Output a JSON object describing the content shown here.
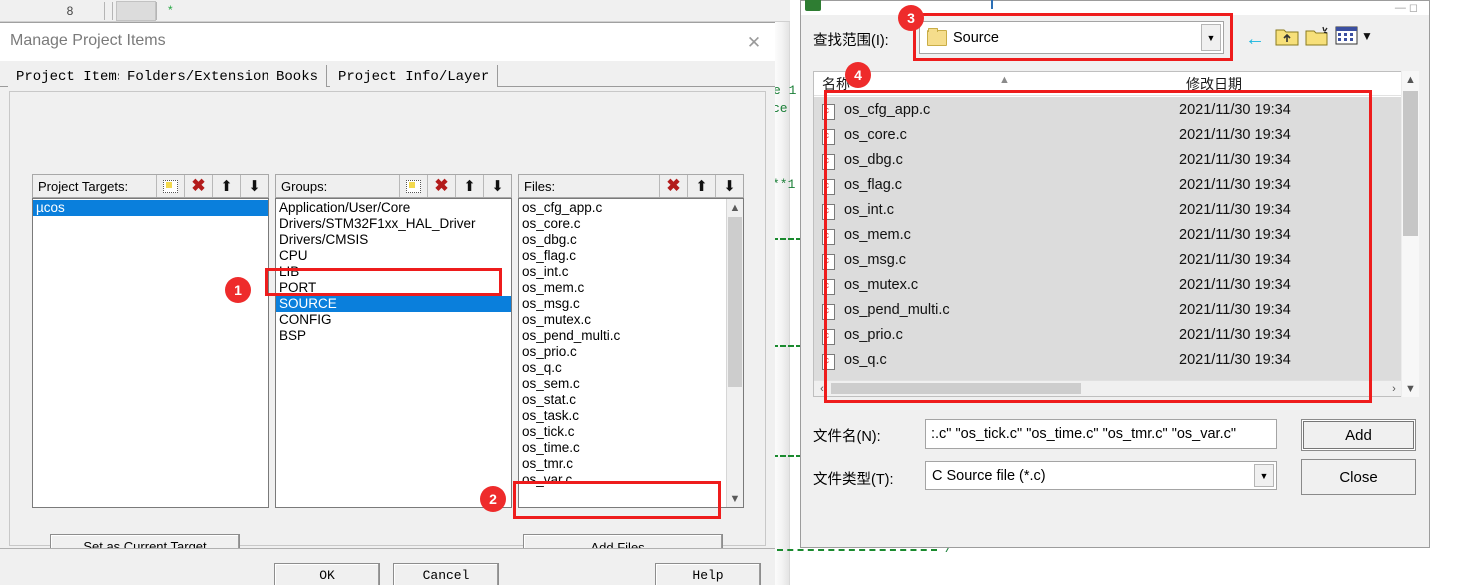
{
  "ide": {
    "toolbar_value": "8",
    "modified_marker": "*"
  },
  "editor": {
    "code_fragments": [
      "e 1",
      "ce",
      "**1"
    ]
  },
  "manage_dialog": {
    "title": "Manage Project Items",
    "close_icon": "close-icon",
    "tabs": [
      {
        "label": "Project Items",
        "active": true
      },
      {
        "label": "Folders/Extensions",
        "active": false
      },
      {
        "label": "Books",
        "active": false
      },
      {
        "label": "Project Info/Layer",
        "active": false
      }
    ],
    "project_targets": {
      "label": "Project Targets:",
      "toolbar_icons": [
        "new-item-icon",
        "delete-icon",
        "move-up-icon",
        "move-down-icon"
      ],
      "items": [
        "µcos"
      ],
      "selected_index": 0
    },
    "groups": {
      "label": "Groups:",
      "toolbar_icons": [
        "new-item-icon",
        "delete-icon",
        "move-up-icon",
        "move-down-icon"
      ],
      "items": [
        "Application/User/Core",
        "Drivers/STM32F1xx_HAL_Driver",
        "Drivers/CMSIS",
        "CPU",
        "LIB",
        "PORT",
        "SOURCE",
        "CONFIG",
        "BSP"
      ],
      "selected_index": 6
    },
    "files": {
      "label": "Files:",
      "toolbar_icons": [
        "delete-icon",
        "move-up-icon",
        "move-down-icon"
      ],
      "items": [
        "os_cfg_app.c",
        "os_core.c",
        "os_dbg.c",
        "os_flag.c",
        "os_int.c",
        "os_mem.c",
        "os_msg.c",
        "os_mutex.c",
        "os_pend_multi.c",
        "os_prio.c",
        "os_q.c",
        "os_sem.c",
        "os_stat.c",
        "os_task.c",
        "os_tick.c",
        "os_time.c",
        "os_tmr.c",
        "os_var.c"
      ]
    },
    "set_as_current_target_label": "Set as Current Target",
    "add_files_label": "Add Files...",
    "footer": {
      "ok_label": "OK",
      "cancel_label": "Cancel",
      "help_label": "Help"
    }
  },
  "add_files_dialog": {
    "look_in_label": "查找范围(I):",
    "look_in_value": "Source",
    "nav_icons": [
      "back-arrow-icon",
      "up-folder-icon",
      "new-folder-icon",
      "view-mode-icon"
    ],
    "columns": [
      "名称",
      "修改日期"
    ],
    "rows": [
      {
        "name": "os_cfg_app.c",
        "date": "2021/11/30 19:34"
      },
      {
        "name": "os_core.c",
        "date": "2021/11/30 19:34"
      },
      {
        "name": "os_dbg.c",
        "date": "2021/11/30 19:34"
      },
      {
        "name": "os_flag.c",
        "date": "2021/11/30 19:34"
      },
      {
        "name": "os_int.c",
        "date": "2021/11/30 19:34"
      },
      {
        "name": "os_mem.c",
        "date": "2021/11/30 19:34"
      },
      {
        "name": "os_msg.c",
        "date": "2021/11/30 19:34"
      },
      {
        "name": "os_mutex.c",
        "date": "2021/11/30 19:34"
      },
      {
        "name": "os_pend_multi.c",
        "date": "2021/11/30 19:34"
      },
      {
        "name": "os_prio.c",
        "date": "2021/11/30 19:34"
      },
      {
        "name": "os_q.c",
        "date": "2021/11/30 19:34"
      }
    ],
    "file_name_label": "文件名(N):",
    "file_name_value": ":.c\" \"os_tick.c\" \"os_time.c\" \"os_tmr.c\" \"os_var.c\"",
    "file_type_label": "文件类型(T):",
    "file_type_value": "C Source file (*.c)",
    "add_label": "Add",
    "close_label": "Close"
  },
  "annotations": {
    "badges": [
      "1",
      "2",
      "3",
      "4"
    ],
    "accent_color": "#ee2b2b"
  }
}
